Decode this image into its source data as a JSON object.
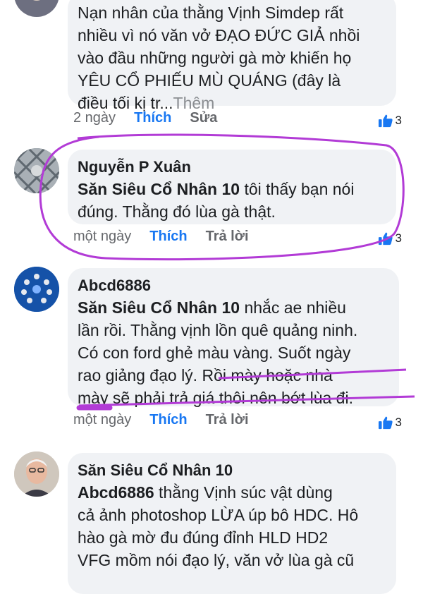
{
  "comments": [
    {
      "author_line": "",
      "body_lines": [
        "Nạn nhân của thằng Vịnh Simdep rất",
        "nhiều vì nó văn vở ĐẠO ĐỨC GIẢ nhồi",
        "vào đầu những người gà mờ khiến họ",
        "YÊU CỔ PHIẾU MÙ QUÁNG (đây là",
        "điều tối kị tr..."
      ],
      "more": "Thêm",
      "time": "2 ngày",
      "like": "Thích",
      "action": "Sửa",
      "reaction_count": "3"
    },
    {
      "author": "Nguyễn P Xuân",
      "mention": "Săn Siêu Cổ Nhân 10",
      "text_first": "  tôi thấy bạn nói",
      "text_rest": "đúng. Thằng đó lùa gà thật.",
      "time": "một ngày",
      "like": "Thích",
      "action": "Trả lời",
      "reaction_count": "3"
    },
    {
      "author": "Abcd6886",
      "mention": "Săn Siêu Cổ Nhân 10",
      "text_first": "  nhắc ae nhiều",
      "lines": [
        "lần rồi. Thằng vịnh lồn quê quảng ninh.",
        "Có con ford ghẻ màu vàng. Suốt ngày",
        "rao giảng đạo lý. Rồi mày hoặc nhà",
        "mày sẽ phải trả giá thôi nên bớt lùa đi."
      ],
      "time": "một ngày",
      "like": "Thích",
      "action": "Trả lời",
      "reaction_count": "3"
    },
    {
      "author": "Săn Siêu Cổ Nhân 10",
      "mention": "Abcd6886",
      "text_first": "  thằng Vịnh súc vật dùng",
      "lines": [
        "cả ảnh photoshop LỪA úp bô HDC. Hô",
        "hào gà mờ đu đúng đỉnh HLD HD2",
        "VFG mồm nói đạo lý, văn vở lùa gà cũ"
      ]
    }
  ],
  "colors": {
    "like_blue": "#1877f2",
    "annotation_purple": "#b23bd6",
    "bubble_bg": "#f0f2f5"
  },
  "icons": {
    "reaction": "thumbs-up-icon"
  }
}
